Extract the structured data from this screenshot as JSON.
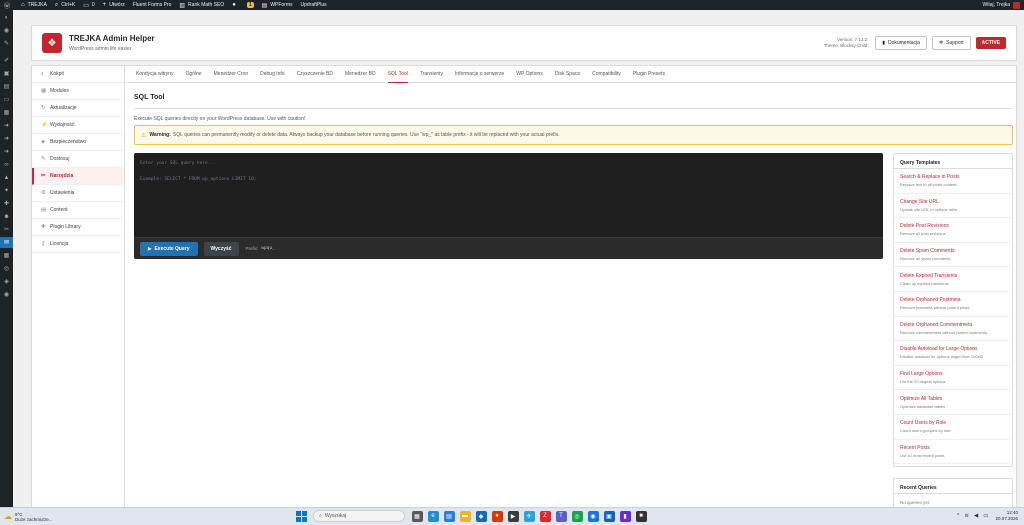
{
  "adminbar": {
    "site_name": "TREJKA",
    "shortcut": "Ctrl+K",
    "comments_count": "0",
    "new_label": "Utwórz",
    "items": [
      "Fluent Forms Pro",
      "Rank Math SEO",
      "WPForms",
      "UpdraftPlus"
    ],
    "badge": "1",
    "greeting": "Witaj, Trejka"
  },
  "plugin": {
    "title": "TREJKA Admin Helper",
    "subtitle": "WordPress admin life easier",
    "version": "Version: 7.13.2",
    "theme": "Theme: Blocksy Child",
    "docs_label": "Dokumentacja",
    "support_label": "Support",
    "status": "ACTIVE"
  },
  "sidenav": [
    {
      "label": "Kokpit",
      "icon": "dashboard-icon",
      "active": false
    },
    {
      "label": "Modules",
      "icon": "modules-icon",
      "active": false
    },
    {
      "label": "Aktualizacje",
      "icon": "updates-icon",
      "active": false
    },
    {
      "label": "Wydajność",
      "icon": "performance-icon",
      "active": false
    },
    {
      "label": "Bezpieczeństwo",
      "icon": "shield-icon",
      "active": false
    },
    {
      "label": "Dostosuj",
      "icon": "customize-icon",
      "active": false
    },
    {
      "label": "Narzędzia",
      "icon": "tools-icon",
      "active": true
    },
    {
      "label": "Ustawienia",
      "icon": "settings-icon",
      "active": false
    },
    {
      "label": "Content",
      "icon": "content-icon",
      "active": false
    },
    {
      "label": "Plugin Library",
      "icon": "library-icon",
      "active": false
    },
    {
      "label": "Licencja",
      "icon": "key-icon",
      "active": false
    }
  ],
  "tabs": [
    {
      "label": "Kondycja witryny",
      "active": false
    },
    {
      "label": "Ogólne",
      "active": false
    },
    {
      "label": "Menedżer Cron",
      "active": false
    },
    {
      "label": "Debug Info",
      "active": false
    },
    {
      "label": "Czyszczenie BD",
      "active": false
    },
    {
      "label": "Menedżer BD",
      "active": false
    },
    {
      "label": "SQL Tool",
      "active": true
    },
    {
      "label": "Transienty",
      "active": false
    },
    {
      "label": "Informacje o serwerze",
      "active": false
    },
    {
      "label": "WP Options",
      "active": false
    },
    {
      "label": "Disk Space",
      "active": false
    },
    {
      "label": "Compatibility",
      "active": false
    },
    {
      "label": "Plugin Presets",
      "active": false
    }
  ],
  "sql_tool": {
    "title": "SQL Tool",
    "description": "Execute SQL queries directly on your WordPress database. Use with caution!",
    "warning_label": "Warning:",
    "warning_text": "SQL queries can permanently modify or delete data. Always backup your database before running queries. Use \"wp_\" as table prefix - it will be replaced with your actual prefix.",
    "editor_placeholder": "Enter your SQL query here...\n\nExample: SELECT * FROM wp_options LIMIT 10;",
    "execute_label": "Execute Query",
    "clear_label": "Wyczyść",
    "prefix_label": "Prefix:",
    "prefix_value": "wpqu_"
  },
  "templates": {
    "title": "Query Templates",
    "items": [
      {
        "name": "Search & Replace in Posts",
        "desc": "Replace text in all posts content"
      },
      {
        "name": "Change Site URL",
        "desc": "Update site URL in options table"
      },
      {
        "name": "Delete Post Revisions",
        "desc": "Remove all post revisions"
      },
      {
        "name": "Delete Spam Comments",
        "desc": "Remove all spam comments"
      },
      {
        "name": "Delete Expired Transients",
        "desc": "Clean up expired transients"
      },
      {
        "name": "Delete Orphaned Postmeta",
        "desc": "Remove postmeta without parent posts"
      },
      {
        "name": "Delete Orphaned Commentmeta",
        "desc": "Remove commentmeta without parent comments"
      },
      {
        "name": "Disable Autoload for Large Options",
        "desc": "Disable autoload for options larger than 100KB"
      },
      {
        "name": "Find Large Options",
        "desc": "List the 20 largest options"
      },
      {
        "name": "Optimize All Tables",
        "desc": "Optimize database tables"
      },
      {
        "name": "Count Users by Role",
        "desc": "Count users grouped by role"
      },
      {
        "name": "Recent Posts",
        "desc": "List 10 most recent posts"
      }
    ]
  },
  "recent": {
    "title": "Recent Queries",
    "empty": "No queries yet."
  },
  "taskbar": {
    "temp": "9°C",
    "weather": "Duże zachmurze...",
    "search": "Wyszukaj",
    "time": "12:40",
    "date": "20.07.2026"
  },
  "colors": {
    "accent": "#c0282d",
    "primary": "#2271b1",
    "adminbar": "#1d2327"
  }
}
